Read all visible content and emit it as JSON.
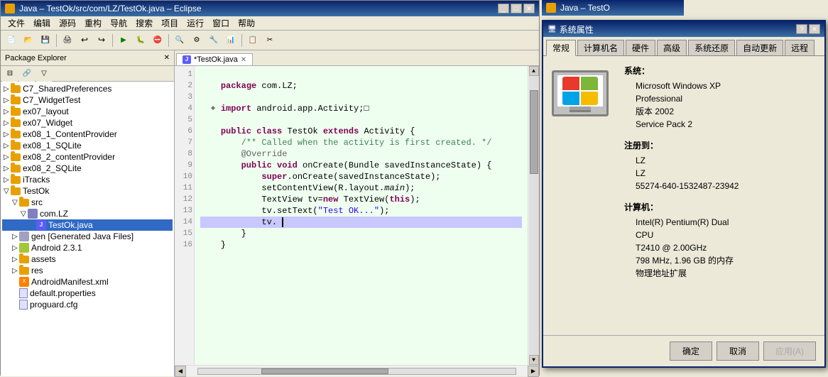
{
  "eclipse": {
    "title": "Java – TestOk/src/com/LZ/TestOk.java – Eclipse",
    "menu_items": [
      "文件",
      "编辑",
      "源码",
      "重构",
      "导航",
      "搜索",
      "项目",
      "运行",
      "窗口",
      "帮助"
    ],
    "editor_tab": "*TestOk.java",
    "code_lines": [
      "",
      "    package com.LZ;",
      "",
      "  + import android.app.Activity;□",
      "",
      "    public class TestOk extends Activity {",
      "        /** Called when the activity is first created. */",
      "        @Override",
      "        public void onCreate(Bundle savedInstanceState) {",
      "            super.onCreate(savedInstanceState);",
      "            setContentView(R.layout.main);",
      "            TextView tv=new TextView(this);",
      "            tv.setText(\"Test OK...\");",
      "            tv.",
      "        }",
      "    }"
    ],
    "panel_title": "Package Explorer",
    "tree_items": [
      {
        "label": "C7_SharedPreferences",
        "indent": 0,
        "type": "folder",
        "expanded": false
      },
      {
        "label": "C7_WidgetTest",
        "indent": 0,
        "type": "folder",
        "expanded": false
      },
      {
        "label": "ex07_layout",
        "indent": 0,
        "type": "folder",
        "expanded": false
      },
      {
        "label": "ex07_Widget",
        "indent": 0,
        "type": "folder",
        "expanded": false
      },
      {
        "label": "ex08_1_ContentProvider",
        "indent": 0,
        "type": "folder",
        "expanded": false
      },
      {
        "label": "ex08_1_SQLite",
        "indent": 0,
        "type": "folder",
        "expanded": false
      },
      {
        "label": "ex08_2_contentProvider",
        "indent": 0,
        "type": "folder",
        "expanded": false
      },
      {
        "label": "ex08_2_SQLite",
        "indent": 0,
        "type": "folder",
        "expanded": false
      },
      {
        "label": "iTracks",
        "indent": 0,
        "type": "folder",
        "expanded": false
      },
      {
        "label": "TestOk",
        "indent": 0,
        "type": "folder",
        "expanded": true
      },
      {
        "label": "src",
        "indent": 1,
        "type": "folder",
        "expanded": true
      },
      {
        "label": "com.LZ",
        "indent": 2,
        "type": "pkg",
        "expanded": true
      },
      {
        "label": "TestOk.java",
        "indent": 3,
        "type": "java",
        "selected": true
      },
      {
        "label": "gen [Generated Java Files]",
        "indent": 1,
        "type": "gen",
        "expanded": false
      },
      {
        "label": "Android 2.3.1",
        "indent": 1,
        "type": "android",
        "expanded": false
      },
      {
        "label": "assets",
        "indent": 1,
        "type": "folder",
        "expanded": false
      },
      {
        "label": "res",
        "indent": 1,
        "type": "folder",
        "expanded": false
      },
      {
        "label": "AndroidManifest.xml",
        "indent": 1,
        "type": "xml"
      },
      {
        "label": "default.properties",
        "indent": 1,
        "type": "file"
      },
      {
        "label": "proguard.cfg",
        "indent": 1,
        "type": "file"
      }
    ]
  },
  "sysprop": {
    "title": "系统属性",
    "tabs": [
      "常规",
      "计算机名",
      "硬件",
      "高级",
      "系统还原",
      "自动更新",
      "远程"
    ],
    "active_tab": "常规",
    "system_label": "系统：",
    "system_info": {
      "os": "Microsoft Windows XP",
      "edition": "Professional",
      "version_label": "版本 2002",
      "service_pack": "Service Pack 2"
    },
    "registered_label": "注册到：",
    "registered_info": {
      "name1": "LZ",
      "name2": "LZ",
      "serial": "55274-640-1532487-23942"
    },
    "computer_label": "计算机：",
    "computer_info": {
      "cpu": "Intel(R) Pentium(R) Dual",
      "cpu2": "CPU",
      "model": "T2410  @ 2.00GHz",
      "memory": "798 MHz, 1.96 GB 的内存",
      "suffix": "物理地址扩展"
    },
    "btn_ok": "确定",
    "btn_cancel": "取消",
    "btn_apply": "应用(A)"
  },
  "second_eclipse_title": "Java – TestO"
}
